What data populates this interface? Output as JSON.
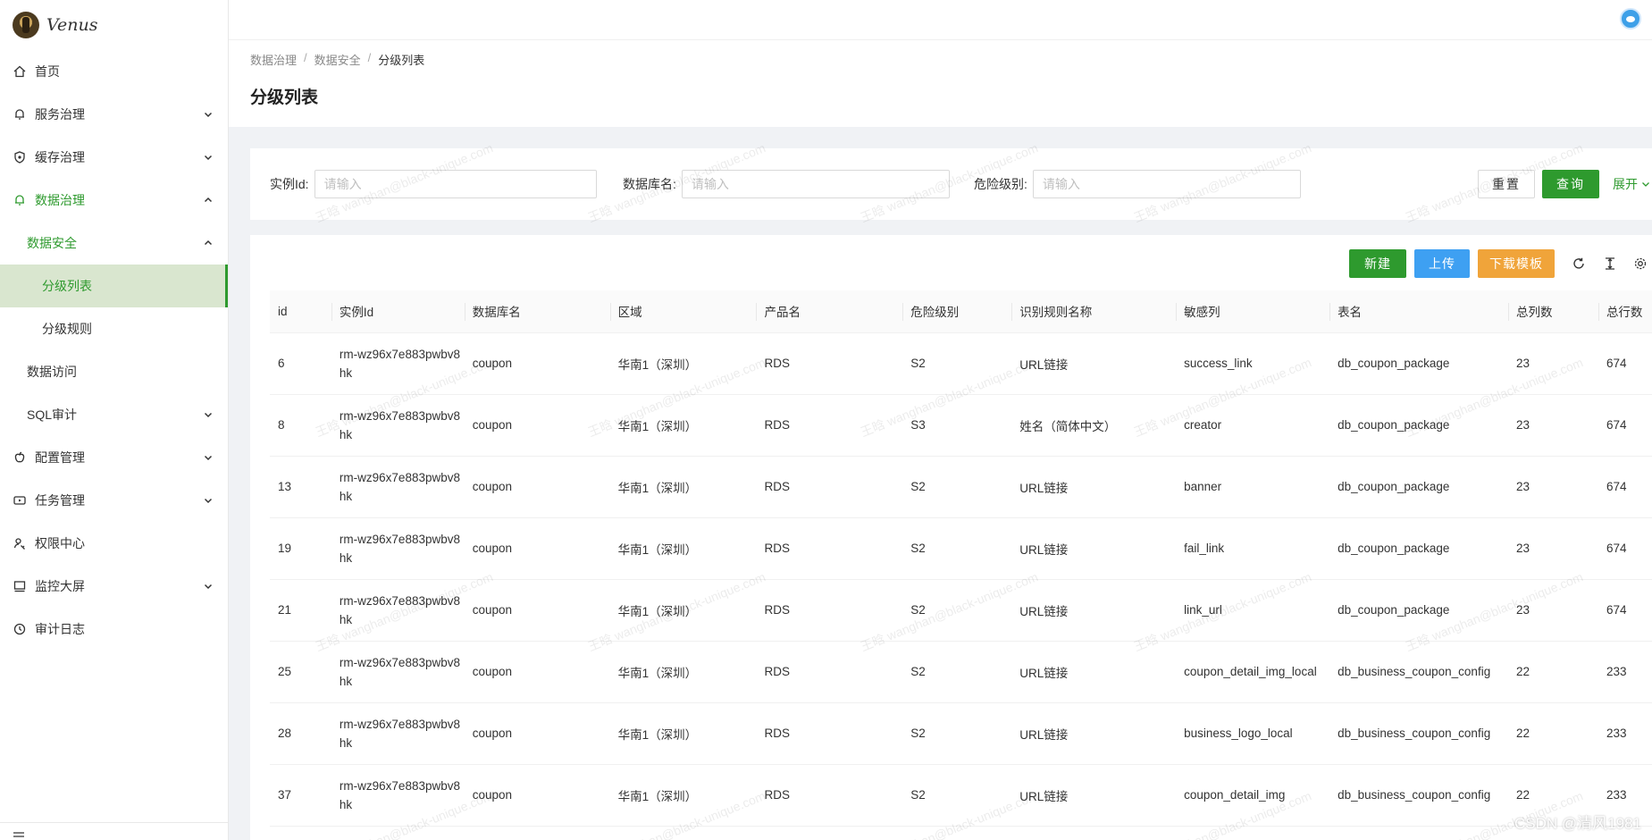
{
  "app": {
    "logo_text": "Venus"
  },
  "sidebar": {
    "items": [
      {
        "label": "首页",
        "icon": "home-icon"
      },
      {
        "label": "服务治理",
        "icon": "bell-icon"
      },
      {
        "label": "缓存治理",
        "icon": "shield-icon"
      },
      {
        "label": "数据治理",
        "icon": "bell-icon"
      },
      {
        "label": "数据安全"
      },
      {
        "label": "分级列表"
      },
      {
        "label": "分级规则"
      },
      {
        "label": "数据访问"
      },
      {
        "label": "SQL审计"
      },
      {
        "label": "配置管理",
        "icon": "apple-icon"
      },
      {
        "label": "任务管理",
        "icon": "video-icon"
      },
      {
        "label": "权限中心",
        "icon": "user-key-icon"
      },
      {
        "label": "监控大屏",
        "icon": "monitor-icon"
      },
      {
        "label": "审计日志",
        "icon": "clock-icon"
      }
    ]
  },
  "breadcrumb": {
    "level1": "数据治理",
    "level2": "数据安全",
    "level3": "分级列表",
    "separator": "/"
  },
  "page": {
    "title": "分级列表"
  },
  "search": {
    "instance_label": "实例Id:",
    "instance_placeholder": "请输入",
    "db_label": "数据库名:",
    "db_placeholder": "请输入",
    "risk_label": "危险级别:",
    "risk_placeholder": "请输入",
    "reset_label": "重置",
    "query_label": "查询",
    "expand_label": "展开"
  },
  "toolbar": {
    "new_label": "新建",
    "upload_label": "上传",
    "download_label": "下载模板"
  },
  "colors": {
    "primary": "#2e9a2e",
    "upload": "#3ea0f2",
    "download": "#f0a43a",
    "selected_bg": "#d9e6cf"
  },
  "table": {
    "headers": [
      "id",
      "实例Id",
      "数据库名",
      "区域",
      "产品名",
      "危险级别",
      "识别规则名称",
      "敏感列",
      "表名",
      "总列数",
      "总行数"
    ],
    "rows": [
      [
        "6",
        "rm-wz96x7e883pwbv8hk",
        "coupon",
        "华南1（深圳）",
        "RDS",
        "S2",
        "URL链接",
        "success_link",
        "db_coupon_package",
        "23",
        "674"
      ],
      [
        "8",
        "rm-wz96x7e883pwbv8hk",
        "coupon",
        "华南1（深圳）",
        "RDS",
        "S3",
        "姓名（简体中文）",
        "creator",
        "db_coupon_package",
        "23",
        "674"
      ],
      [
        "13",
        "rm-wz96x7e883pwbv8hk",
        "coupon",
        "华南1（深圳）",
        "RDS",
        "S2",
        "URL链接",
        "banner",
        "db_coupon_package",
        "23",
        "674"
      ],
      [
        "19",
        "rm-wz96x7e883pwbv8hk",
        "coupon",
        "华南1（深圳）",
        "RDS",
        "S2",
        "URL链接",
        "fail_link",
        "db_coupon_package",
        "23",
        "674"
      ],
      [
        "21",
        "rm-wz96x7e883pwbv8hk",
        "coupon",
        "华南1（深圳）",
        "RDS",
        "S2",
        "URL链接",
        "link_url",
        "db_coupon_package",
        "23",
        "674"
      ],
      [
        "25",
        "rm-wz96x7e883pwbv8hk",
        "coupon",
        "华南1（深圳）",
        "RDS",
        "S2",
        "URL链接",
        "coupon_detail_img_local",
        "db_business_coupon_config",
        "22",
        "233"
      ],
      [
        "28",
        "rm-wz96x7e883pwbv8hk",
        "coupon",
        "华南1（深圳）",
        "RDS",
        "S2",
        "URL链接",
        "business_logo_local",
        "db_business_coupon_config",
        "22",
        "233"
      ],
      [
        "37",
        "rm-wz96x7e883pwbv8hk",
        "coupon",
        "华南1（深圳）",
        "RDS",
        "S2",
        "URL链接",
        "coupon_detail_img",
        "db_business_coupon_config",
        "22",
        "233"
      ]
    ]
  },
  "watermark": {
    "text": "王晗 wanghan@black-unique.com"
  },
  "footer": {
    "credit": "CSDN @清风1981"
  }
}
